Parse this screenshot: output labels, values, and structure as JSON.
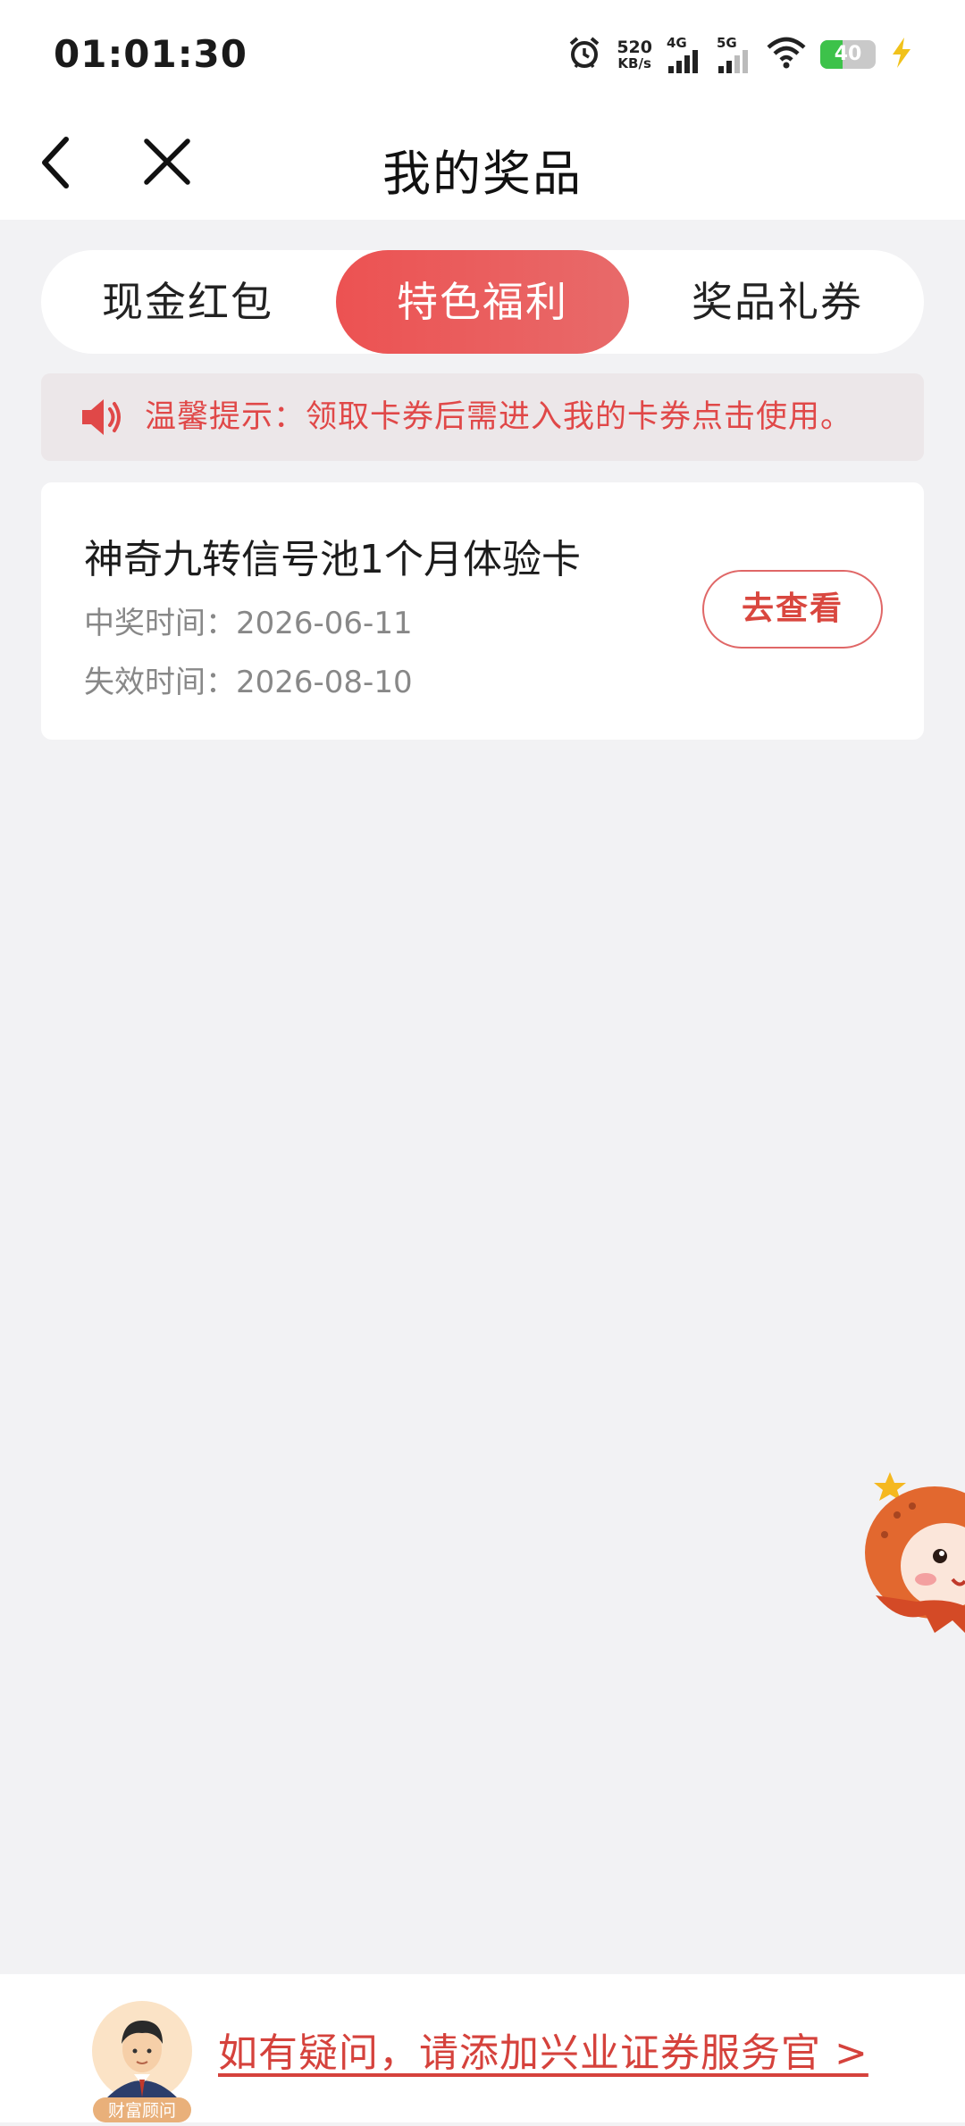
{
  "status_bar": {
    "time": "01:01:30",
    "net_speed_value": "520",
    "net_speed_unit": "KB/s",
    "sim1_label": "4G",
    "sim2_label": "5G",
    "battery_level": "40",
    "battery_fraction": 0.4
  },
  "nav": {
    "title": "我的奖品"
  },
  "tabs": [
    {
      "label": "现金红包"
    },
    {
      "label": "特色福利"
    },
    {
      "label": "奖品礼券"
    }
  ],
  "selected_tab_index": 1,
  "notice": {
    "text": "温馨提示：领取卡券后需进入我的卡券点击使用。"
  },
  "prize_card": {
    "title": "神奇九转信号池1个月体验卡",
    "win_time": "中奖时间：2026-06-11",
    "expire_time": "失效时间：2026-08-10",
    "button_label": "去查看"
  },
  "footer": {
    "advisor_badge": "财富顾问",
    "link_text": "如有疑问，请添加兴业证券服务官 >"
  },
  "colors": {
    "accent_red": "#e04848",
    "tab_active_start": "#ec5252",
    "tab_active_end": "#e86a6a",
    "page_bg": "#f2f2f4",
    "battery_green": "#3dc24a"
  }
}
